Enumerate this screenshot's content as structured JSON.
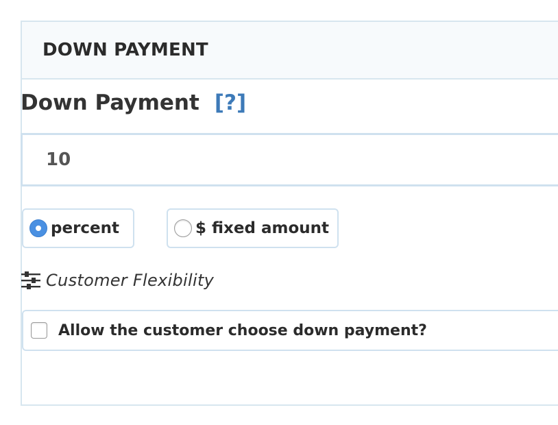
{
  "panel": {
    "title": "DOWN PAYMENT"
  },
  "field": {
    "label": "Down Payment",
    "help": "[?]",
    "value": "10"
  },
  "type_options": [
    {
      "label": "percent",
      "selected": true
    },
    {
      "label": "$ fixed amount",
      "selected": false
    }
  ],
  "flexibility": {
    "icon": "sliders-icon",
    "heading": "Customer Flexibility",
    "checkbox_label": "Allow the customer choose down payment?",
    "checked": false
  },
  "colors": {
    "accent": "#4a90e2",
    "link": "#3d7ab8",
    "border": "#cfe1ef",
    "header_bg": "#f7fafc"
  }
}
